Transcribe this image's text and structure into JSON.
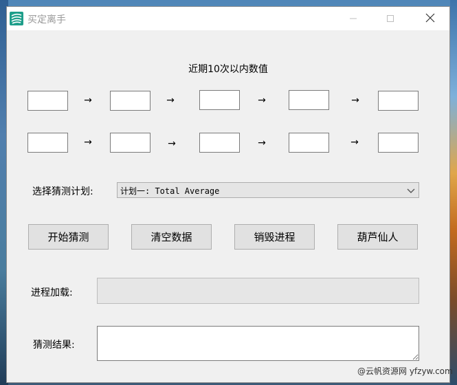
{
  "window": {
    "title": "买定离手",
    "icon": "green-feather-icon"
  },
  "title_buttons": [
    "minimize-icon",
    "maximize-icon",
    "close-icon"
  ],
  "main": {
    "heading": "近期10次以内数值",
    "rows": [
      {
        "boxes": [
          "",
          "",
          "",
          "",
          ""
        ],
        "arrows": [
          "→",
          "→",
          "→",
          "→"
        ]
      },
      {
        "boxes": [
          "",
          "",
          "",
          "",
          ""
        ],
        "arrows": [
          "→",
          "→",
          "→",
          "→"
        ]
      }
    ],
    "plan": {
      "label": "选择猜测计划:",
      "selected": "计划一: Total Average"
    },
    "buttons": {
      "start": "开始猜测",
      "clear": "清空数据",
      "destroy": "销毁进程",
      "gourd": "葫芦仙人"
    },
    "progress": {
      "label": "进程加载:",
      "value": 0
    },
    "result": {
      "label": "猜测结果:",
      "value": ""
    }
  },
  "watermark": "@云帆资源网 yfzyw.com"
}
